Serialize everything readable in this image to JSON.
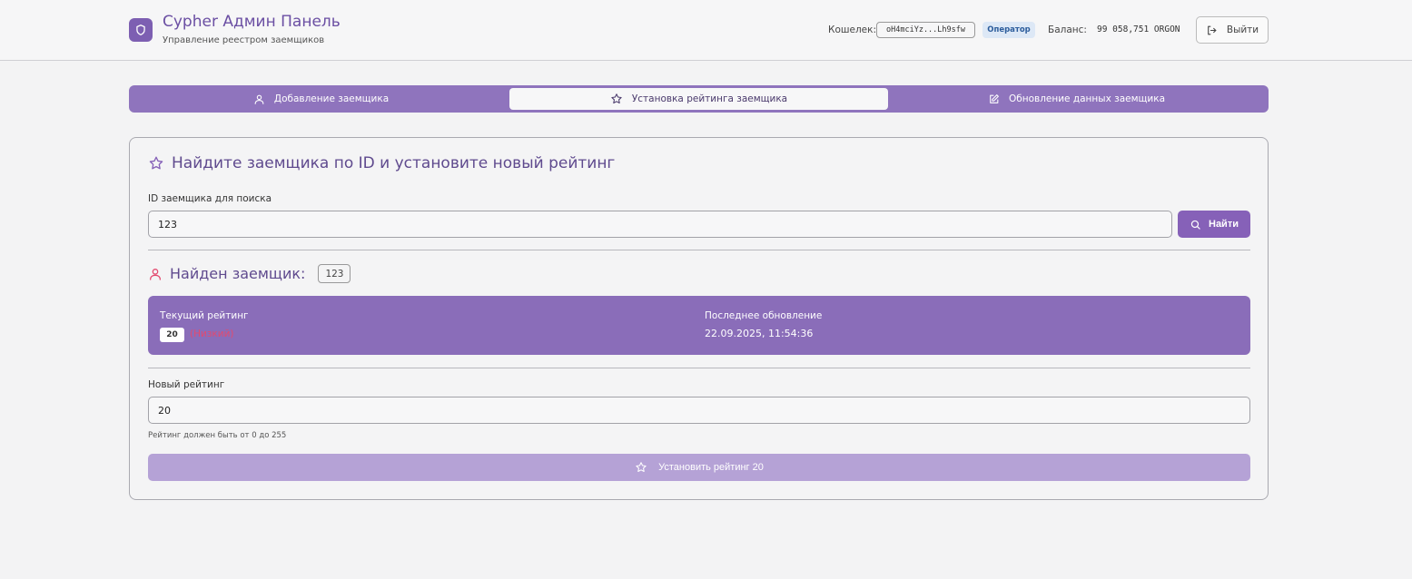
{
  "header": {
    "title": "Cypher Админ Панель",
    "subtitle": "Управление реестром заемщиков",
    "wallet_label": "Кошелек:",
    "wallet_address": "oH4mciYz...Lh9sfw",
    "role": "Оператор",
    "balance_label": "Баланс:",
    "balance_value": "99 058,751 ORGON",
    "logout_label": "Выйти",
    "logo_icon": "shield-icon"
  },
  "tabs": [
    {
      "label": "Добавление заемщика",
      "icon": "user-icon",
      "active": false
    },
    {
      "label": "Установка рейтинга заемщика",
      "icon": "star-icon",
      "active": true
    },
    {
      "label": "Обновление данных заемщика",
      "icon": "edit-icon",
      "active": false
    }
  ],
  "rating_form": {
    "title": "Найдите заемщика по ID и установите новый рейтинг",
    "search_label": "ID заемщика для поиска",
    "search_value": "123",
    "find_button": "Найти",
    "found_label": "Найден заемщик:",
    "found_id": "123",
    "current_rating_label": "Текущий рейтинг",
    "current_rating_value": "20",
    "current_rating_status": "(Низкий)",
    "last_update_label": "Последнее обновление",
    "last_update_value": "22.09.2025, 11:54:36",
    "new_rating_label": "Новый рейтинг",
    "new_rating_value": "20",
    "hint": "Рейтинг должен быть от 0 до 255",
    "submit_button": "Установить рейтинг 20"
  },
  "colors": {
    "accent": "#8661b8",
    "tab_bar": "#8f74bd",
    "info_panel": "#8a6db9",
    "submit_disabled": "#b5a2d6",
    "status_low": "#e34a6f",
    "title_text": "#5f4a8e"
  }
}
